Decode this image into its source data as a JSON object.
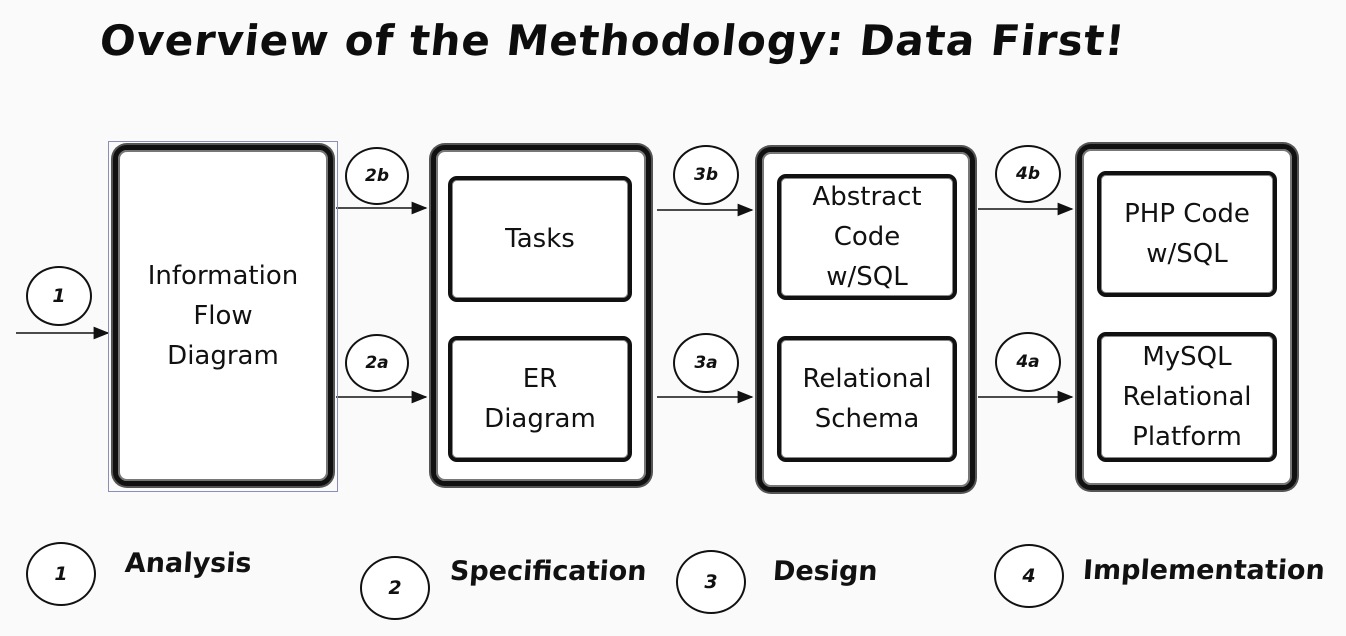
{
  "title": "Overview of the Methodology: Data First!",
  "boxes": {
    "information_flow": "Information\nFlow\nDiagram",
    "tasks": "Tasks",
    "er_diagram": "ER\nDiagram",
    "abstract_code": "Abstract\nCode\nw/SQL",
    "relational_schema": "Relational\nSchema",
    "php_code": "PHP Code\nw/SQL",
    "mysql_platform": "MySQL\nRelational\nPlatform"
  },
  "step_markers": {
    "s1": "1",
    "s2a": "2a",
    "s2b": "2b",
    "s3a": "3a",
    "s3b": "3b",
    "s4a": "4a",
    "s4b": "4b"
  },
  "legend": [
    {
      "number": "1",
      "label": "Analysis"
    },
    {
      "number": "2",
      "label": "Specification"
    },
    {
      "number": "3",
      "label": "Design"
    },
    {
      "number": "4",
      "label": "Implementation"
    }
  ]
}
